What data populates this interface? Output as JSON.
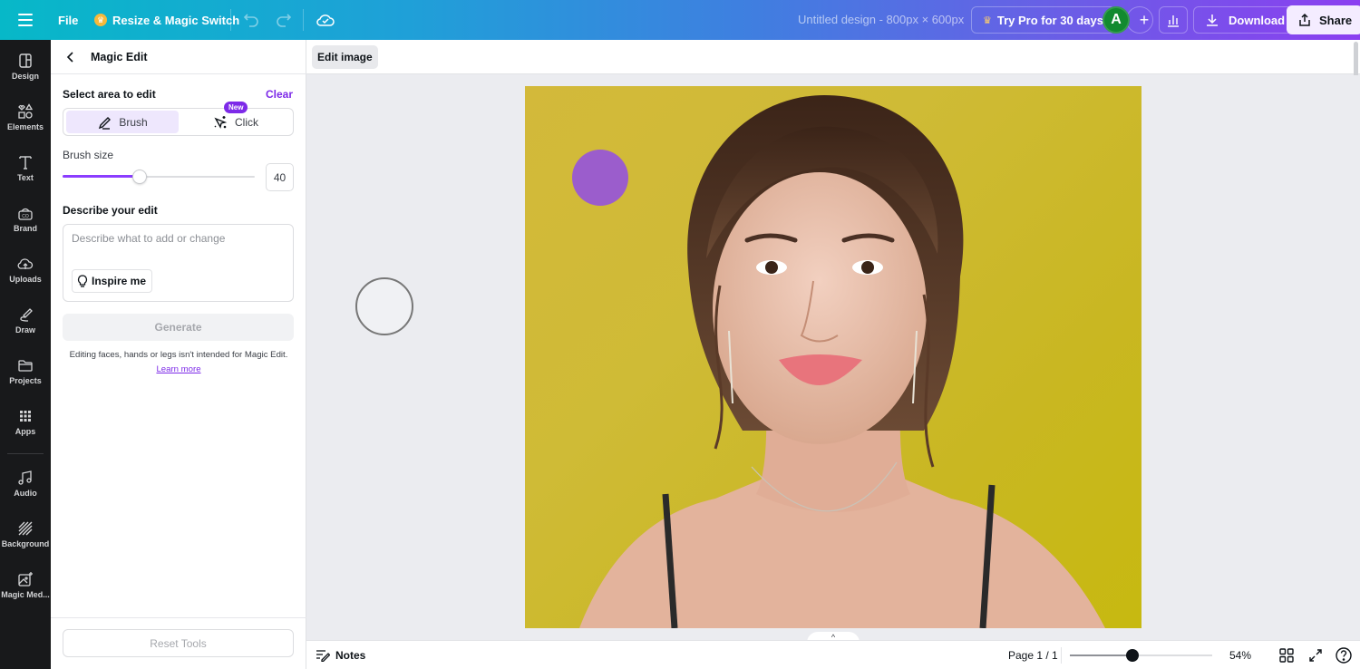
{
  "topbar": {
    "menu_icon": "hamburger-icon",
    "file_label": "File",
    "resize_label": "Resize & Magic Switch",
    "resize_icon": "crown-icon",
    "undo_icon": "undo-icon",
    "redo_icon": "redo-icon",
    "save_status_icon": "cloud-check-icon",
    "document_title": "Untitled design - 800px × 600px",
    "try_pro_label": "Try Pro for 30 days",
    "avatar_initial": "A",
    "add_collaborator_label": "+",
    "download_label": "Download",
    "share_label": "Share",
    "colors": {
      "gradient_start": "#07b8c8",
      "gradient_end": "#8b3ff0",
      "avatar": "#128a2f"
    }
  },
  "leftnav": {
    "items": [
      {
        "label": "Design",
        "icon": "layout-icon"
      },
      {
        "label": "Elements",
        "icon": "shapes-icon"
      },
      {
        "label": "Text",
        "icon": "text-icon"
      },
      {
        "label": "Brand",
        "icon": "brand-kit-icon"
      },
      {
        "label": "Uploads",
        "icon": "cloud-upload-icon"
      },
      {
        "label": "Draw",
        "icon": "pen-icon"
      },
      {
        "label": "Projects",
        "icon": "folder-icon"
      },
      {
        "label": "Apps",
        "icon": "apps-grid-icon"
      },
      {
        "label": "Audio",
        "icon": "music-note-icon"
      },
      {
        "label": "Background",
        "icon": "hatch-pattern-icon"
      },
      {
        "label": "Magic Med...",
        "icon": "magic-media-icon"
      }
    ]
  },
  "panel": {
    "title": "Magic Edit",
    "select_area_label": "Select area to edit",
    "clear_label": "Clear",
    "modes": [
      {
        "label": "Brush",
        "icon": "brush-icon",
        "active": true
      },
      {
        "label": "Click",
        "icon": "magic-click-icon",
        "active": false,
        "badge": "New"
      }
    ],
    "brush_size_label": "Brush size",
    "brush_size_value": "40",
    "brush_size_fraction": 0.4,
    "describe_label": "Describe your edit",
    "describe_placeholder": "Describe what to add or change",
    "describe_value": "",
    "inspire_label": "Inspire me",
    "generate_label": "Generate",
    "disclaimer": "Editing faces, hands or legs isn't intended for Magic Edit.",
    "learn_more_label": "Learn more",
    "reset_label": "Reset Tools",
    "accent_color": "#7d2ae8"
  },
  "canvas": {
    "context_button_label": "Edit image",
    "brush_mark_color": "#9b5dcc",
    "image_background_color": "#cfbb36",
    "image_description": "Portrait of a woman with brown hair on a yellow background"
  },
  "bottombar": {
    "notes_label": "Notes",
    "page_indicator": "Page 1 / 1",
    "zoom_level": "54%",
    "zoom_fraction": 0.44,
    "show_pages_label": "^"
  }
}
